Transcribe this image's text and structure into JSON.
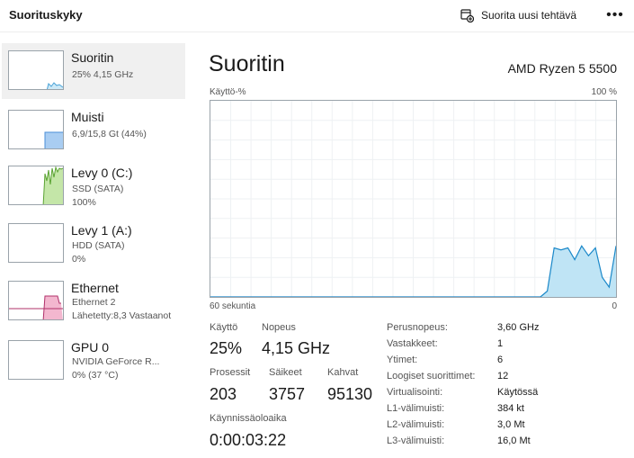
{
  "header": {
    "title": "Suorituskyky",
    "run_task_label": "Suorita uusi tehtävä",
    "more_label": "•••"
  },
  "sidebar": {
    "items": [
      {
        "name": "Suoritin",
        "sub1": "25% 4,15 GHz",
        "sub2": "",
        "sub3": "",
        "color": "#4aa3d8",
        "fill": "#cde9f7"
      },
      {
        "name": "Muisti",
        "sub1": "6,9/15,8 Gt (44%)",
        "sub2": "",
        "sub3": "",
        "color": "#4a8fd8",
        "fill": "#a9cdf2"
      },
      {
        "name": "Levy 0 (C:)",
        "sub1": "SSD (SATA)",
        "sub2": "100%",
        "sub3": "",
        "color": "#5aa332",
        "fill": "#c4e6a8"
      },
      {
        "name": "Levy 1 (A:)",
        "sub1": "HDD (SATA)",
        "sub2": "0%",
        "sub3": "",
        "color": "#5aa332",
        "fill": "#c4e6a8"
      },
      {
        "name": "Ethernet",
        "sub1": "Ethernet 2",
        "sub2": "Lähetetty:8,3 Vastaanot",
        "sub3": "",
        "color": "#b0306a",
        "fill": "#f3b7cf"
      },
      {
        "name": "GPU 0",
        "sub1": "NVIDIA GeForce R...",
        "sub2": "0% (37 °C)",
        "sub3": "",
        "color": "#4aa3d8",
        "fill": "#cde9f7"
      }
    ]
  },
  "main": {
    "title": "Suoritin",
    "model": "AMD Ryzen 5 5500",
    "graph": {
      "y_label": "Käyttö-%",
      "y_max_label": "100 %",
      "x_left_label": "60 sekuntia",
      "x_right_label": "0",
      "line_color": "#1a88c9",
      "fill_color": "#bfe4f5",
      "usage_percent": [
        0,
        0,
        0,
        0,
        0,
        0,
        0,
        0,
        0,
        0,
        0,
        0,
        0,
        0,
        0,
        0,
        0,
        0,
        0,
        0,
        0,
        0,
        0,
        0,
        0,
        0,
        0,
        0,
        0,
        0,
        0,
        0,
        0,
        0,
        0,
        0,
        0,
        0,
        0,
        0,
        0,
        0,
        0,
        0,
        0,
        0,
        0,
        0,
        0,
        3,
        25,
        24,
        25,
        19,
        26,
        21,
        25,
        10,
        5,
        26
      ]
    },
    "stats": {
      "usage_label": "Käyttö",
      "usage_value": "25%",
      "speed_label": "Nopeus",
      "speed_value": "4,15 GHz",
      "processes_label": "Prosessit",
      "processes_value": "203",
      "threads_label": "Säikeet",
      "threads_value": "3757",
      "handles_label": "Kahvat",
      "handles_value": "95130",
      "uptime_label": "Käynnissäoloaika",
      "uptime_value": "0:00:03:22"
    },
    "specs": [
      {
        "label": "Perusnopeus:",
        "value": "3,60 GHz"
      },
      {
        "label": "Vastakkeet:",
        "value": "1"
      },
      {
        "label": "Ytimet:",
        "value": "6"
      },
      {
        "label": "Loogiset suorittimet:",
        "value": "12"
      },
      {
        "label": "Virtualisointi:",
        "value": "Käytössä"
      },
      {
        "label": "L1-välimuisti:",
        "value": "384 kt"
      },
      {
        "label": "L2-välimuisti:",
        "value": "3,0 Mt"
      },
      {
        "label": "L3-välimuisti:",
        "value": "16,0 Mt"
      }
    ]
  }
}
